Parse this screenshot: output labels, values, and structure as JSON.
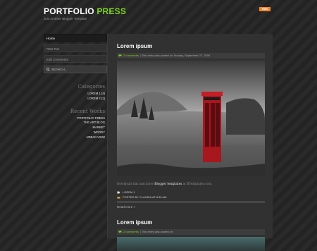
{
  "site": {
    "title_white": "PORTFOLIO",
    "title_green": "PRESS",
    "tagline": "Just Another Blogger Template",
    "rss_label": "RSS"
  },
  "sidebar": {
    "nav": [
      {
        "label": "Home"
      },
      {
        "label": "RSS Pos"
      },
      {
        "label": "Edit Comments"
      }
    ],
    "search_placeholder": "SEARCH...",
    "categories": {
      "title": "Categories",
      "items": [
        "LOREM 1 (4)",
        "LOREM 2 (2)"
      ]
    },
    "recent_works": {
      "title": "Recent Works",
      "items": [
        "PORTFOLIO PRESS",
        "THE ART BLOG",
        "MARKET",
        "WOODY",
        "URBAN VIEW"
      ]
    }
  },
  "posts": [
    {
      "title": "Lorem ipsum",
      "comments": "2 comments",
      "meta": "| This entry was posted on Sunday, September 27, 2009",
      "caption_prefix": "Download this and more",
      "caption_bold": "Blogger templates",
      "caption_suffix": "at BTemplates.com",
      "label": "LOREM 1",
      "posted_by": "POSTED BY CLAUDIA AT 8:50 AM",
      "read_more": "Read more »"
    },
    {
      "title": "Lorem ipsum",
      "comments": "2 comments",
      "meta": "| This entry was posted on"
    }
  ]
}
